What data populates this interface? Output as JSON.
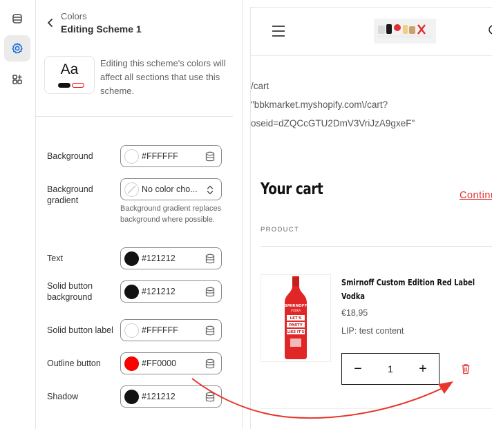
{
  "panel": {
    "breadcrumb": "Colors",
    "title": "Editing Scheme 1",
    "preview_text": "Aa",
    "info_text": "Editing this scheme's colors will affect all sections that use this scheme."
  },
  "colors": [
    {
      "label": "Background",
      "value": "#FFFFFF",
      "swatch": "#FFFFFF"
    },
    {
      "label": "Background gradient",
      "value": "No color cho...",
      "swatch": "none"
    },
    {
      "label": "Text",
      "value": "#121212",
      "swatch": "#121212"
    },
    {
      "label": "Solid button background",
      "value": "#121212",
      "swatch": "#121212"
    },
    {
      "label": "Solid button label",
      "value": "#FFFFFF",
      "swatch": "#FFFFFF"
    },
    {
      "label": "Outline button",
      "value": "#FF0000",
      "swatch": "#FF0000"
    },
    {
      "label": "Shadow",
      "value": "#121212",
      "swatch": "#121212"
    }
  ],
  "gradient_hint": "Background gradient replaces background where possible.",
  "store": {
    "url_lines": [
      "/cart",
      "\"bbkmarket.myshopify.com\\/cart?",
      "oseid=dZQCcGTU2DmV3VriJzA9gxeF\""
    ],
    "cart_title": "Your cart",
    "continue_label": "Continu",
    "product_header": "PRODUCT",
    "product": {
      "name_line1": "Smirnoff Custom Edition Red Label",
      "name_line2": "Vodka",
      "price": "€18,95",
      "lip": "LIP: test content",
      "quantity": "1",
      "bottle_text": [
        "SMIRNOFF",
        "VODKA",
        "LET'S",
        "PARTY",
        "LIKE IT'S"
      ]
    },
    "qty_minus": "−",
    "qty_plus": "+"
  },
  "accent_colors": {
    "annotation": "#e8362b",
    "link": "#e03131"
  }
}
